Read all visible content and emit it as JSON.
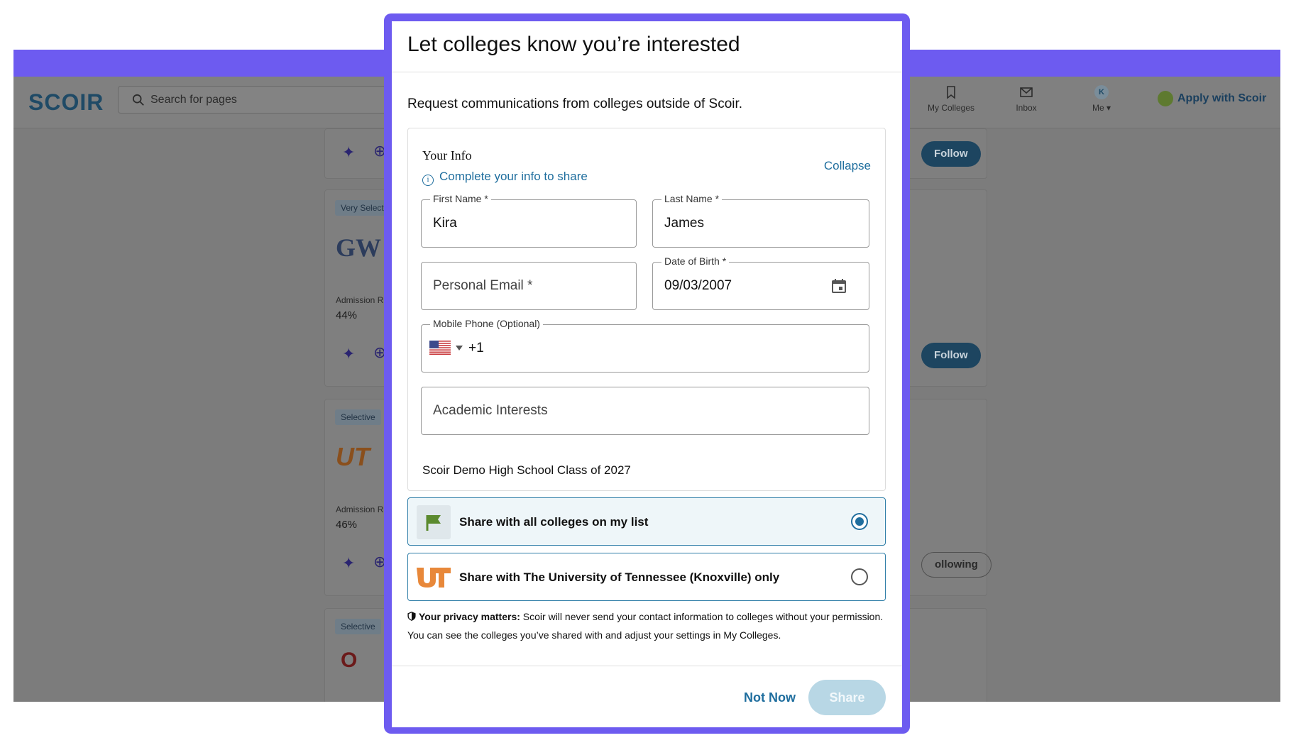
{
  "background": {
    "logo": "SCOIR",
    "search_placeholder": "Search for pages",
    "nav": {
      "my_colleges": "My Colleges",
      "inbox": "Inbox",
      "me": "Me",
      "avatar_initial": "K"
    },
    "apply_label": "Apply with Scoir",
    "cards": [
      {
        "badge": "",
        "follow": "Follow"
      },
      {
        "badge": "Very Select",
        "stat_label": "Admission R",
        "stat": "44%",
        "follow": "Follow",
        "logo": "GW"
      },
      {
        "badge": "Selective",
        "stat_label": "Admission R",
        "stat": "46%",
        "follow": "ollowing",
        "logo": "UT"
      },
      {
        "badge": "Selective",
        "logo": "O"
      }
    ]
  },
  "modal": {
    "title": "Let colleges know you’re interested",
    "subtitle": "Request communications from colleges outside of Scoir.",
    "your_info": "Your Info",
    "complete_info": "Complete your info to share",
    "collapse": "Collapse",
    "fields": {
      "first_name_label": "First Name *",
      "first_name_value": "Kira",
      "last_name_label": "Last Name *",
      "last_name_value": "James",
      "email_placeholder": "Personal Email *",
      "dob_label": "Date of Birth *",
      "dob_value": "09/03/2007",
      "phone_label": "Mobile Phone (Optional)",
      "phone_dial": "+1",
      "academic_placeholder": "Academic Interests"
    },
    "school_line": "Scoir Demo High School Class of 2027",
    "share_all": "Share with all colleges on my list",
    "share_one": "Share with The University of Tennessee (Knoxville) only",
    "selected_option": "share_all",
    "privacy_bold": "Your privacy matters:",
    "privacy_text": " Scoir will never send your contact information to colleges without your permission. You can see the colleges you’ve shared with and adjust your settings in My Colleges.",
    "not_now": "Not Now",
    "share": "Share"
  },
  "colors": {
    "frame": "#6d5bf0",
    "link": "#1f6e9e",
    "ut_orange": "#e8883a",
    "flag_green": "#5b8a2e"
  }
}
